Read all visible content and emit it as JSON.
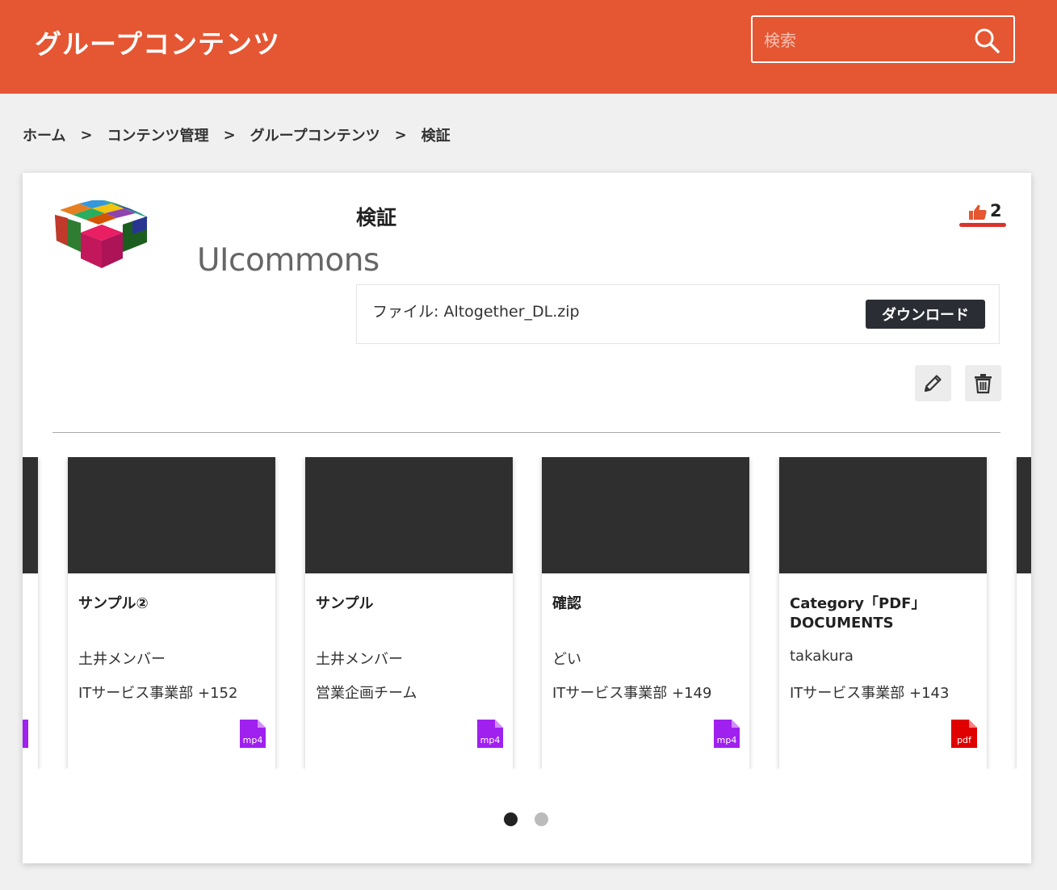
{
  "header": {
    "title": "グループコンテンツ",
    "search_placeholder": "検索",
    "bg_color": "#e55632"
  },
  "breadcrumb": {
    "items": [
      "ホーム",
      "コンテンツ管理",
      "グループコンテンツ",
      "検証"
    ],
    "separator": ">"
  },
  "content": {
    "logo_text": "UIcommons",
    "title": "検証",
    "like_count": "2",
    "file_label": "ファイル: Altogether_DL.zip",
    "download_label": "ダウンロード"
  },
  "carousel": {
    "tiles": [
      {
        "title": "サンプル②",
        "author": "土井メンバー",
        "group": "ITサービス事業部 +152",
        "file_type": "mp4",
        "icon_color": "#a020f0"
      },
      {
        "title": "サンプル",
        "author": "土井メンバー",
        "group": "営業企画チーム",
        "file_type": "mp4",
        "icon_color": "#a020f0"
      },
      {
        "title": "確認",
        "author": "どい",
        "group": "ITサービス事業部 +149",
        "file_type": "mp4",
        "icon_color": "#a020f0"
      },
      {
        "title": "Category「PDF」DOCUMENTS",
        "author": "takakura",
        "group": "ITサービス事業部 +143",
        "file_type": "pdf",
        "icon_color": "#e00000"
      }
    ],
    "pages": 2,
    "active_page": 1
  }
}
